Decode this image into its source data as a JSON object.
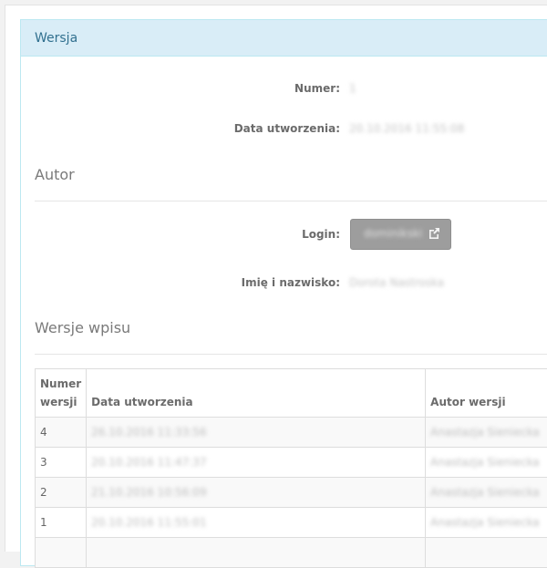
{
  "panel": {
    "title": "Wersja"
  },
  "version": {
    "number_label": "Numer:",
    "number_value": "1",
    "created_label": "Data utworzenia:",
    "created_value": "20.10.2016 11:55:08"
  },
  "author": {
    "section_title": "Autor",
    "login_label": "Login:",
    "login_value": "dominikski",
    "name_label": "Imię i nazwisko:",
    "name_value": "Dorota Nastroska"
  },
  "entry_versions": {
    "section_title": "Wersje wpisu",
    "columns": [
      "Numer wersji",
      "Data utworzenia",
      "Autor wersji"
    ],
    "rows": [
      {
        "number": "4",
        "date": "26.10.2016 11:33:56",
        "author": "Anastazja Sieniecka"
      },
      {
        "number": "3",
        "date": "20.10.2016 11:47:37",
        "author": "Anastazja Sieniecka"
      },
      {
        "number": "2",
        "date": "21.10.2016 10:56:09",
        "author": "Anastazja Sieniecka"
      },
      {
        "number": "1",
        "date": "20.10.2016 11:55:01",
        "author": "Anastazja Sieniecka"
      }
    ]
  }
}
